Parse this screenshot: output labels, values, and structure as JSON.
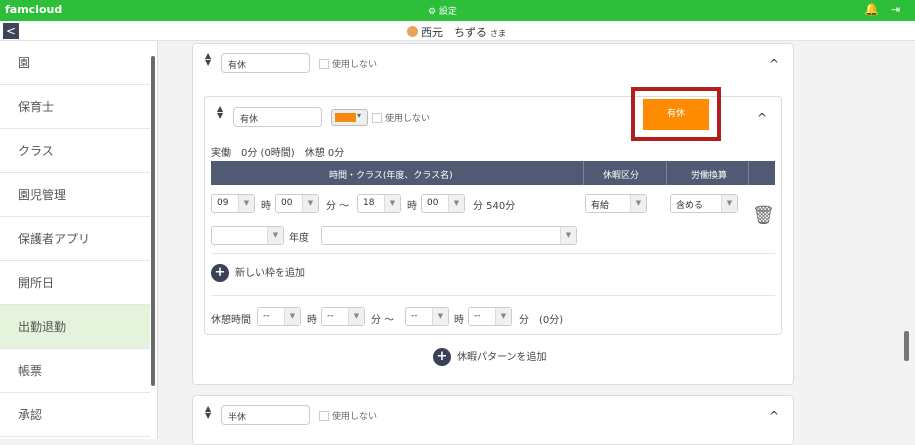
{
  "header": {
    "brand": "famcloud",
    "settings": "⚙ 設定"
  },
  "subheader": {
    "back": "<",
    "user_name": "西元　ちずる",
    "honorific": "さま"
  },
  "sidebar": {
    "items": [
      "園",
      "保育士",
      "クラス",
      "園児管理",
      "保護者アプリ",
      "開所日",
      "出勤退勤",
      "帳票",
      "承認"
    ],
    "active_index": 6
  },
  "patterns": [
    {
      "name": "有休",
      "unused_label": "使用しない"
    },
    {
      "name": "有休",
      "unused_label": "使用しない",
      "color": "#f48a10",
      "preview_label": "有休",
      "summary": "実働　0分 (0時間)　休憩 0分",
      "table_headers": [
        "時間・クラス(年度、クラス名)",
        "休暇区分",
        "労働換算"
      ],
      "row": {
        "start_hour": "09",
        "start_min": "00",
        "end_hour": "18",
        "end_min": "00",
        "h1": "時",
        "sep": "分 〜",
        "duration": "分 540分",
        "year_label": "年度",
        "leave_type": "有給",
        "conversion": "含める"
      },
      "add_slot": "新しい枠を追加",
      "break": {
        "label": "休憩時間",
        "start_hour": "--",
        "start_min": "--",
        "end_hour": "--",
        "end_min": "--",
        "h": "時",
        "sep": "分 〜",
        "total": "分　(0分)"
      }
    },
    {
      "name": "半休",
      "unused_label": "使用しない"
    }
  ],
  "add_pattern": "休暇パターンを追加"
}
